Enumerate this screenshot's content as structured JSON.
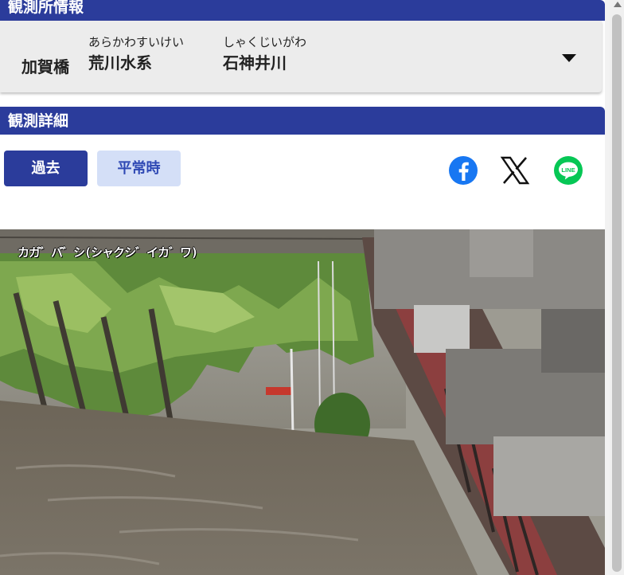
{
  "observation_info": {
    "header": "観測所情報",
    "station_name": "加賀橋",
    "river_system": {
      "ruby": "あらかわすいけい",
      "name": "荒川水系"
    },
    "river": {
      "ruby": "しゃくじいがわ",
      "name": "石神井川"
    }
  },
  "observation_details": {
    "header": "観測詳細",
    "buttons": {
      "past": "過去",
      "normal": "平常時"
    },
    "share": {
      "facebook_icon": "facebook-icon",
      "x_icon": "x-icon",
      "line_icon": "line-icon",
      "line_text": "LINE"
    }
  },
  "camera": {
    "overlay_label": "カガ゛バ゛シ(シャクシ゛イカ゛ワ)"
  },
  "colors": {
    "header_bg": "#2b3c9b",
    "primary_button": "#2b3c9b",
    "secondary_button": "#d4dff7",
    "facebook": "#1877f2",
    "line": "#06c755"
  }
}
